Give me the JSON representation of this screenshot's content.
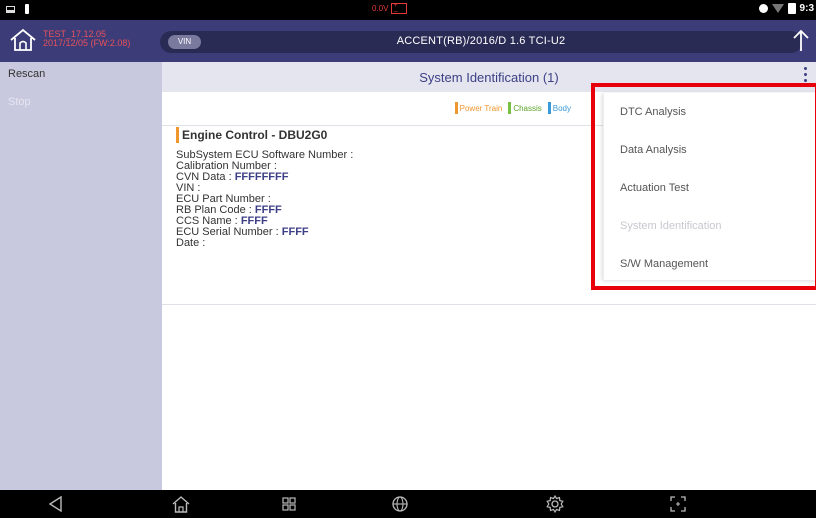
{
  "status_bar": {
    "voltage": "0.0V",
    "time": "9:3"
  },
  "header": {
    "test_line1": "TEST_17.12.05",
    "test_line2": "2017/12/05 (FW:2.08)",
    "vin_label": "VIN",
    "vehicle": "ACCENT(RB)/2016/D 1.6 TCI-U2"
  },
  "left_menu": {
    "items": [
      {
        "label": "Rescan",
        "enabled": true
      },
      {
        "label": "Stop",
        "enabled": false
      }
    ]
  },
  "main": {
    "title": "System Identification (1)",
    "legend": [
      {
        "label": "Power Train",
        "color": "#f0962e"
      },
      {
        "label": "Chassis",
        "color": "#7ac143"
      },
      {
        "label": "Body",
        "color": "#3a9ad9"
      }
    ],
    "ecu": {
      "title": "Engine Control - DBU2G0",
      "fields": [
        {
          "label": "SubSystem ECU Software Number :",
          "value": ""
        },
        {
          "label": "Calibration Number :",
          "value": ""
        },
        {
          "label": "CVN Data :",
          "value": "FFFFFFFF"
        },
        {
          "label": "VIN :",
          "value": ""
        },
        {
          "label": "ECU Part Number :",
          "value": ""
        },
        {
          "label": "RB Plan Code :",
          "value": "FFFF"
        },
        {
          "label": "CCS Name :",
          "value": "FFFF"
        },
        {
          "label": "ECU Serial Number :",
          "value": "FFFF"
        },
        {
          "label": "Date :",
          "value": ""
        }
      ]
    }
  },
  "popup_menu": {
    "items": [
      {
        "label": "DTC Analysis",
        "enabled": true
      },
      {
        "label": "Data Analysis",
        "enabled": true
      },
      {
        "label": "Actuation Test",
        "enabled": true
      },
      {
        "label": "System Identification",
        "enabled": false
      },
      {
        "label": "S/W Management",
        "enabled": true
      }
    ]
  },
  "colors": {
    "header_bg": "#3c3d78",
    "accent": "#3d3f86",
    "highlight_border": "#e8000a"
  }
}
